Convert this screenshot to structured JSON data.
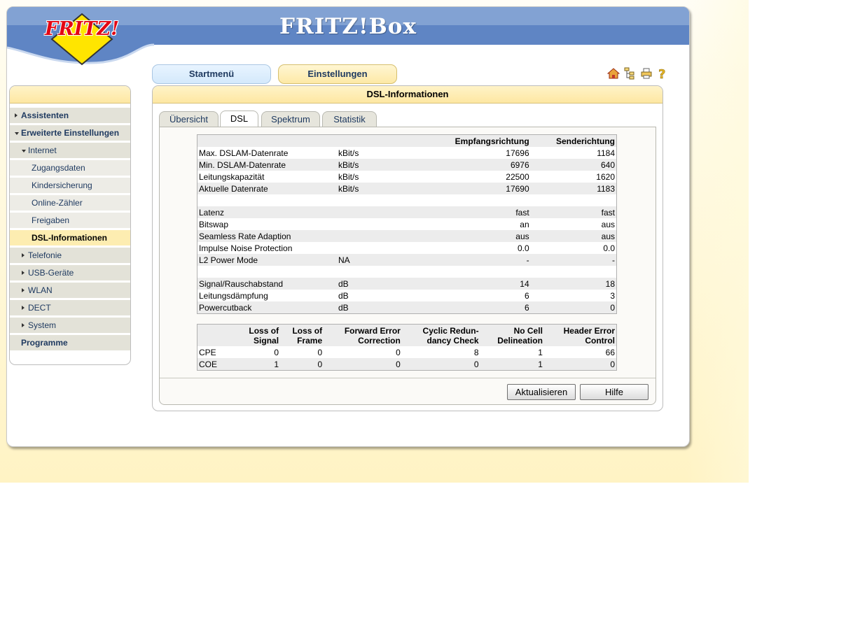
{
  "brand": {
    "logo_text": "FRITZ!",
    "title": "FRITZ!Box"
  },
  "nav": {
    "startmenu": "Startmenü",
    "settings": "Einstellungen"
  },
  "toolbar_icons": [
    "home-icon",
    "sitemap-icon",
    "print-icon",
    "help-icon"
  ],
  "sidebar": {
    "items": [
      {
        "label": "Assistenten",
        "level": 0,
        "arrow": "right"
      },
      {
        "label": "Erweiterte Einstellungen",
        "level": 0,
        "arrow": "down"
      },
      {
        "label": "Internet",
        "level": 1,
        "arrow": "down"
      },
      {
        "label": "Zugangsdaten",
        "level": 2
      },
      {
        "label": "Kindersicherung",
        "level": 2
      },
      {
        "label": "Online-Zähler",
        "level": 2
      },
      {
        "label": "Freigaben",
        "level": 2
      },
      {
        "label": "DSL-Informationen",
        "level": 2,
        "active": true
      },
      {
        "label": "Telefonie",
        "level": 1,
        "arrow": "right"
      },
      {
        "label": "USB-Geräte",
        "level": 1,
        "arrow": "right"
      },
      {
        "label": "WLAN",
        "level": 1,
        "arrow": "right"
      },
      {
        "label": "DECT",
        "level": 1,
        "arrow": "right"
      },
      {
        "label": "System",
        "level": 1,
        "arrow": "right"
      },
      {
        "label": "Programme",
        "level": 0
      }
    ]
  },
  "main": {
    "title": "DSL-Informationen",
    "tabs": [
      "Übersicht",
      "DSL",
      "Spektrum",
      "Statistik"
    ],
    "active_tab": "DSL",
    "info_table": {
      "headers": [
        "",
        "",
        "Empfangsrichtung",
        "Senderichtung"
      ],
      "groups": [
        [
          [
            "Max. DSLAM-Datenrate",
            "kBit/s",
            "17696",
            "1184"
          ],
          [
            "Min. DSLAM-Datenrate",
            "kBit/s",
            "6976",
            "640"
          ],
          [
            "Leitungskapazität",
            "kBit/s",
            "22500",
            "1620"
          ],
          [
            "Aktuelle Datenrate",
            "kBit/s",
            "17690",
            "1183"
          ]
        ],
        [
          [
            "Latenz",
            "",
            "fast",
            "fast"
          ],
          [
            "Bitswap",
            "",
            "an",
            "aus"
          ],
          [
            "Seamless Rate Adaption",
            "",
            "aus",
            "aus"
          ],
          [
            "Impulse Noise Protection",
            "",
            "0.0",
            "0.0"
          ],
          [
            "L2 Power Mode",
            "NA",
            "-",
            "-"
          ]
        ],
        [
          [
            "Signal/Rauschabstand",
            "dB",
            "14",
            "18"
          ],
          [
            "Leitungsdämpfung",
            "dB",
            "6",
            "3"
          ],
          [
            "Powercutback",
            "dB",
            "6",
            "0"
          ]
        ]
      ]
    },
    "error_table": {
      "headers": [
        [
          "",
          ""
        ],
        [
          "Loss of",
          "Signal"
        ],
        [
          "Loss of",
          "Frame"
        ],
        [
          "Forward Error",
          "Correction"
        ],
        [
          "Cyclic Redun-",
          "dancy Check"
        ],
        [
          "No Cell",
          "Delineation"
        ],
        [
          "Header Error",
          "Control"
        ]
      ],
      "rows": [
        [
          "CPE",
          "0",
          "0",
          "0",
          "8",
          "1",
          "66"
        ],
        [
          "COE",
          "1",
          "0",
          "0",
          "0",
          "1",
          "0"
        ]
      ]
    },
    "buttons": {
      "refresh": "Aktualisieren",
      "help": "Hilfe"
    }
  }
}
